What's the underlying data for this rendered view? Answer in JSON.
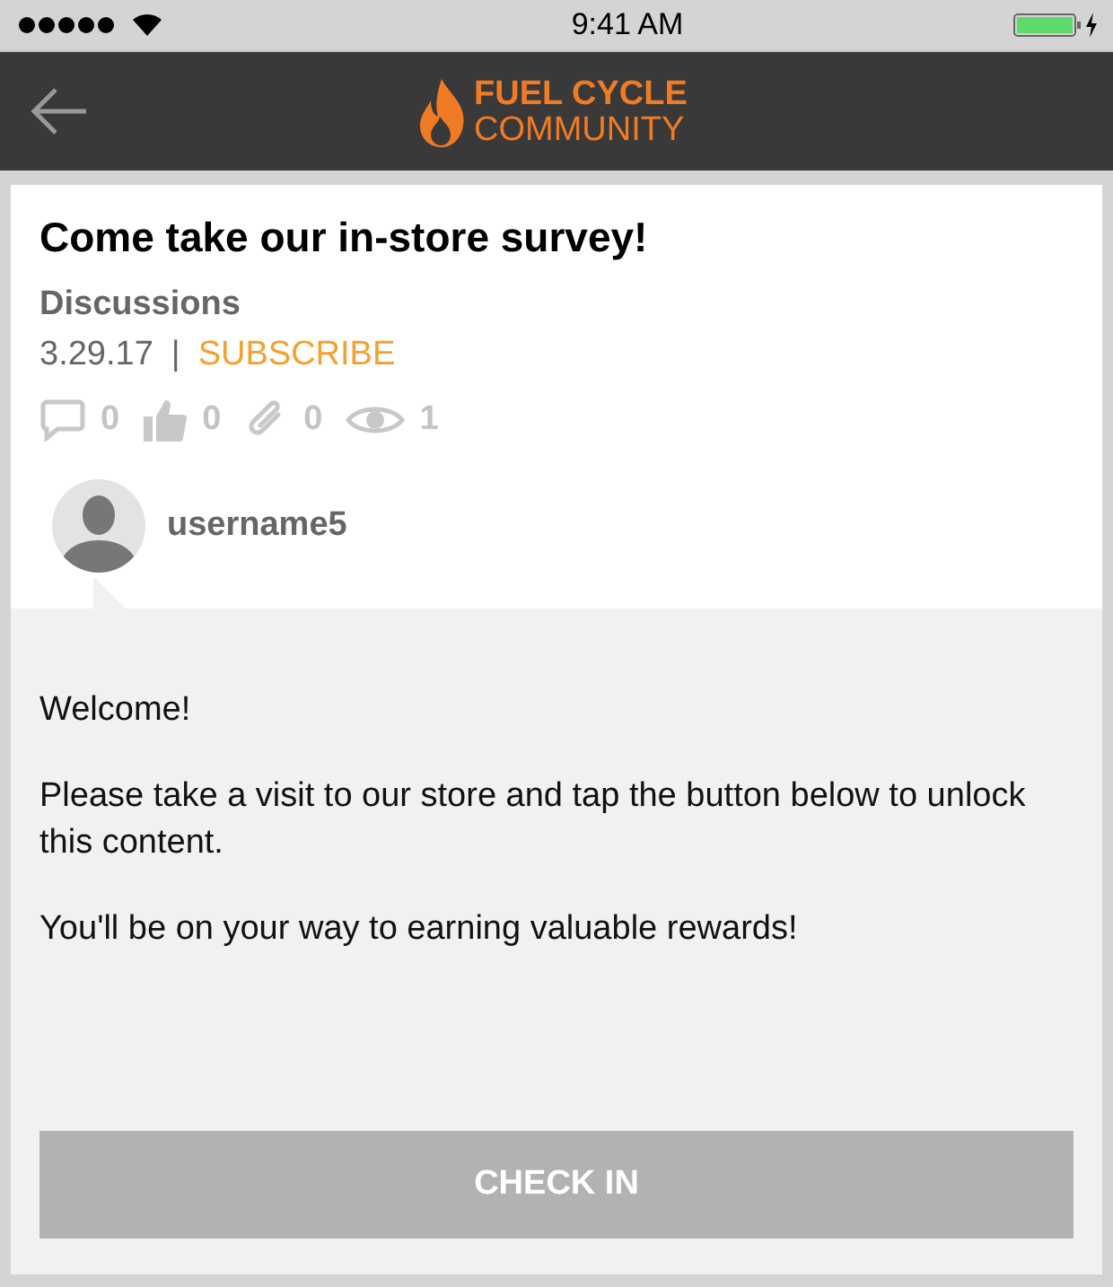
{
  "status_bar": {
    "time": "9:41 AM"
  },
  "header": {
    "logo_top": "FUEL CYCLE",
    "logo_bottom": "COMMUNITY"
  },
  "post": {
    "title": "Come take our in-store survey!",
    "category": "Discussions",
    "date": "3.29.17",
    "separator": "|",
    "subscribe": "SUBSCRIBE",
    "stats": [
      {
        "kind": "comments",
        "count": "0"
      },
      {
        "kind": "likes",
        "count": "0"
      },
      {
        "kind": "attachments",
        "count": "0"
      },
      {
        "kind": "views",
        "count": "1"
      }
    ],
    "author": "username5",
    "paragraphs": [
      "Welcome!",
      "Please take a visit to our store and tap the button below to unlock this content.",
      "You'll be on your way to earning valuable rewards!"
    ],
    "button": {
      "label": "CHECK IN",
      "disabled": true
    }
  }
}
